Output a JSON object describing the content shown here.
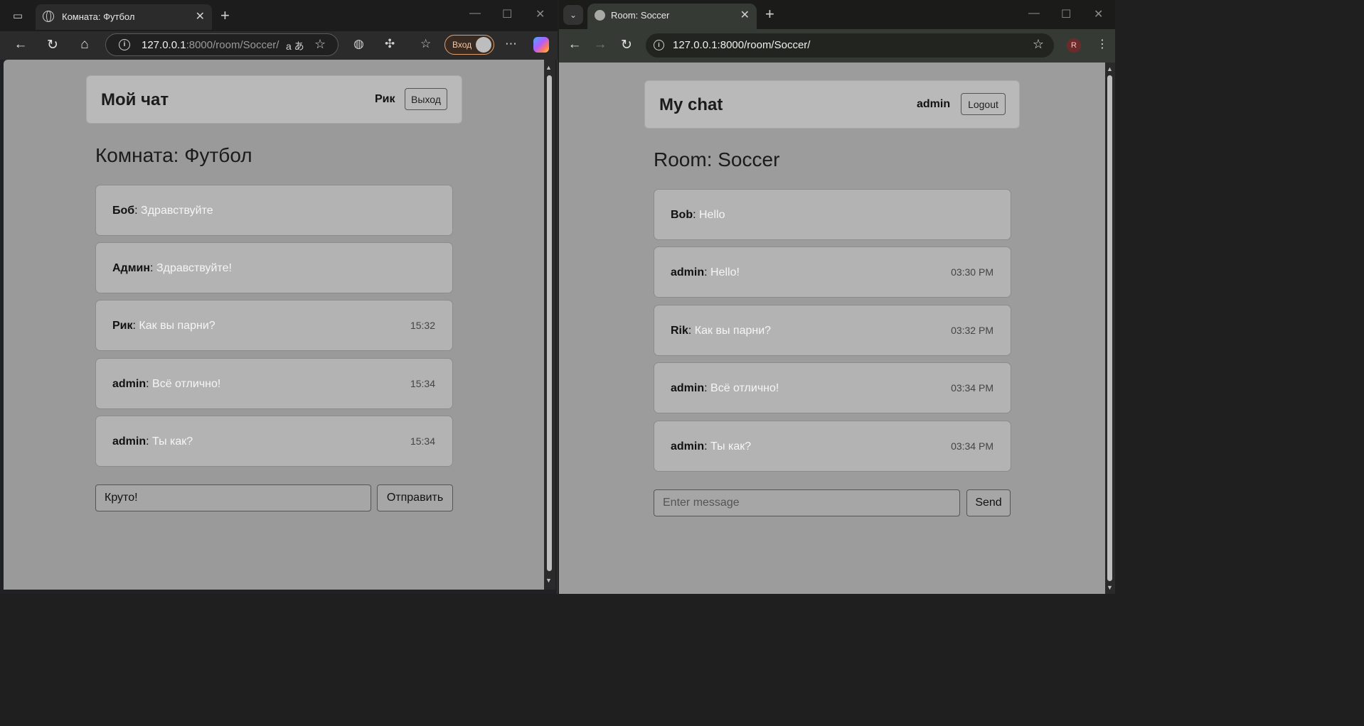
{
  "left": {
    "browser": {
      "tab_title": "Комната: Футбол",
      "url_host": "127.0.0.1",
      "url_path": ":8000/room/Soccer/",
      "login_label": "Вход"
    },
    "app": {
      "brand": "Мой чат",
      "username": "Рик",
      "logout_label": "Выход",
      "room_title": "Комната: Футбол",
      "messages": [
        {
          "author": "Боб",
          "text": "Здравствуйте",
          "time": ""
        },
        {
          "author": "Админ",
          "text": "Здравствуйте!",
          "time": ""
        },
        {
          "author": "Рик",
          "text": "Как вы парни?",
          "time": "15:32"
        },
        {
          "author": "admin",
          "text": "Всё отлично!",
          "time": "15:34"
        },
        {
          "author": "admin",
          "text": "Ты как?",
          "time": "15:34"
        }
      ],
      "input_value": "Круто!",
      "send_label": "Отправить"
    }
  },
  "right": {
    "browser": {
      "tab_title": "Room: Soccer",
      "url": "127.0.0.1:8000/room/Soccer/",
      "profile_initial": "R"
    },
    "app": {
      "brand": "My chat",
      "username": "admin",
      "logout_label": "Logout",
      "room_title": "Room: Soccer",
      "messages": [
        {
          "author": "Bob",
          "text": "Hello",
          "time": ""
        },
        {
          "author": "admin",
          "text": "Hello!",
          "time": "03:30 PM"
        },
        {
          "author": "Rik",
          "text": "Как вы парни?",
          "time": "03:32 PM"
        },
        {
          "author": "admin",
          "text": "Всё отлично!",
          "time": "03:34 PM"
        },
        {
          "author": "admin",
          "text": "Ты как?",
          "time": "03:34 PM"
        }
      ],
      "input_placeholder": "Enter message",
      "send_label": "Send"
    }
  }
}
